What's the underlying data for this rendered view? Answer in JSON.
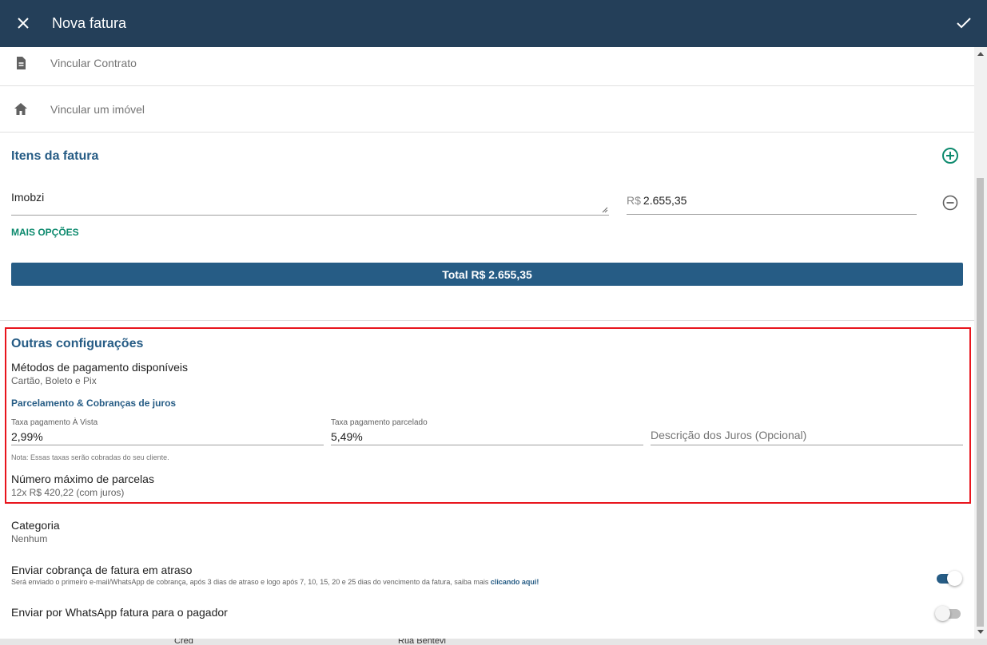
{
  "header": {
    "title": "Nova fatura",
    "close_icon": "close-icon",
    "confirm_icon": "check-icon"
  },
  "links": {
    "contract": "Vincular Contrato",
    "property": "Vincular um imóvel"
  },
  "items_section": {
    "title": "Itens da fatura",
    "item_description": "Imobzi",
    "currency": "R$",
    "item_value": "2.655,35",
    "more_options": "MAIS OPÇÕES",
    "total_label": "Total R$ 2.655,35"
  },
  "other_config": {
    "title": "Outras configurações",
    "payment_methods_label": "Métodos de pagamento disponíveis",
    "payment_methods_value": "Cartão, Boleto e Pix",
    "installments_heading": "Parcelamento & Cobranças de juros",
    "fee_cash_caption": "Taxa pagamento À Vista",
    "fee_cash_value": "2,99%",
    "fee_installment_caption": "Taxa pagamento parcelado",
    "fee_installment_value": "5,49%",
    "interest_description_placeholder": "Descrição dos Juros (Opcional)",
    "note": "Nota: Essas taxas serão cobradas do seu cliente.",
    "max_installments_label": "Número máximo de parcelas",
    "max_installments_value": "12x R$ 420,22 (com juros)"
  },
  "category": {
    "label": "Categoria",
    "value": "Nenhum"
  },
  "overdue": {
    "label": "Enviar cobrança de fatura em atraso",
    "description": "Será enviado o primeiro e-mail/WhatsApp de cobrança, após 3 dias de atraso e logo após 7, 10, 15, 20 e 25 dias do vencimento da fatura, saiba mais ",
    "link": "clicando aqui!",
    "enabled": true
  },
  "whatsapp": {
    "label": "Enviar por WhatsApp fatura para o pagador",
    "enabled": false
  },
  "background": {
    "text_left": "Cred",
    "text_right": "Rua Bentevi"
  },
  "colors": {
    "header_bg": "#243f59",
    "accent_blue": "#265c85",
    "accent_green": "#0d8a6e",
    "highlight_border": "#e8141c"
  }
}
